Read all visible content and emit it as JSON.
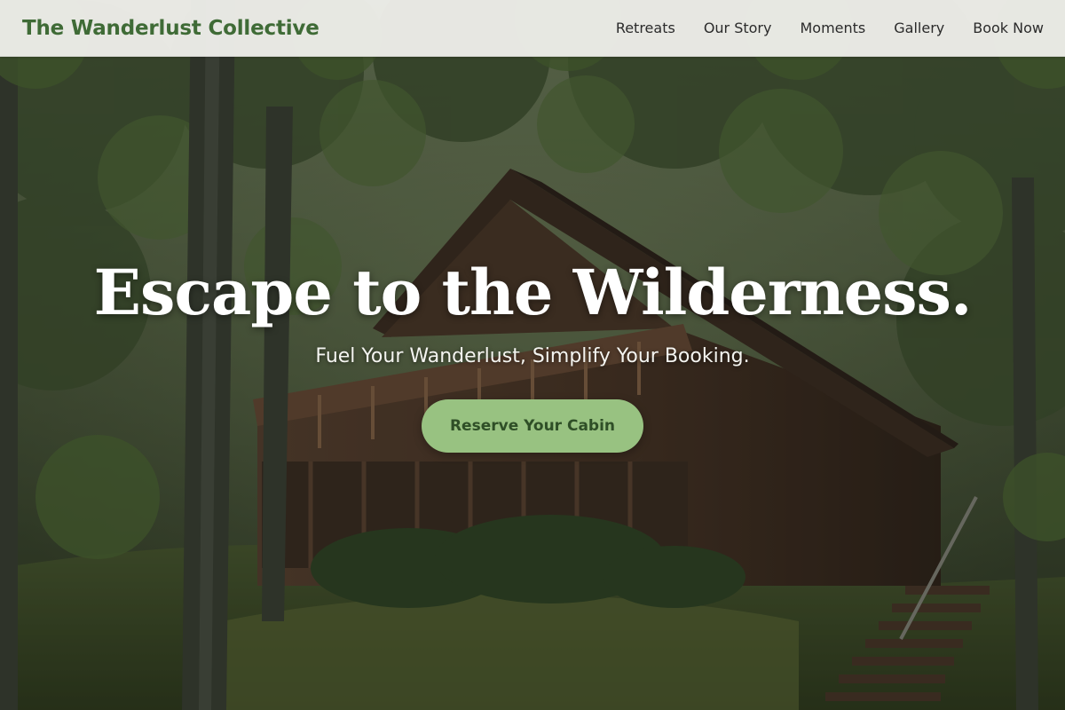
{
  "nav": {
    "brand": "The Wanderlust Collective",
    "links": [
      "Retreats",
      "Our Story",
      "Moments",
      "Gallery",
      "Book Now"
    ]
  },
  "hero": {
    "title": "Escape to the Wilderness.",
    "subtitle": "Fuel Your Wanderlust, Simplify Your Booking.",
    "cta_label": "Reserve Your Cabin",
    "background_image": "forest-cabin-photo"
  },
  "colors": {
    "brand": "#3f6b36",
    "nav_background": "#eeeeea",
    "nav_text": "#2b2b2b",
    "cta_background": "#98c281",
    "cta_text": "#2f4f27",
    "hero_text": "#ffffff"
  }
}
